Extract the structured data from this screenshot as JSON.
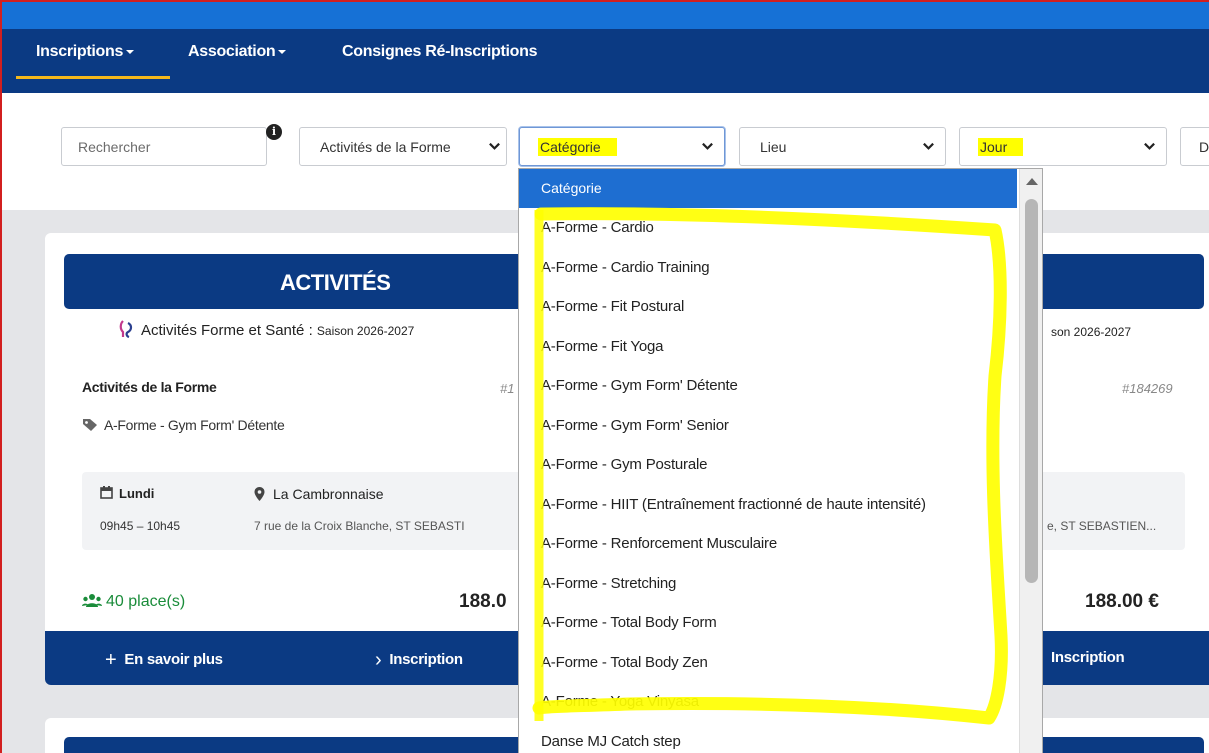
{
  "nav": {
    "inscriptions": "Inscriptions",
    "association": "Association",
    "consignes": "Consignes Ré-Inscriptions"
  },
  "filters": {
    "search_placeholder": "Rechercher",
    "activite": "Activités de la Forme",
    "categorie": "Catégorie",
    "lieu": "Lieu",
    "jour": "Jour",
    "cut": "D"
  },
  "card": {
    "banner_title": "ACTIVITÉS",
    "left": {
      "subtitle_main": "Activités Forme et Santé :",
      "subtitle_season": "Saison 2026-2027",
      "activity_name": "Activités de la Forme",
      "activity_id": "#1",
      "category": "A-Forme - Gym Form' Détente",
      "day": "Lundi",
      "time": "09h45 – 10h45",
      "place": "La Cambronnaise",
      "address": "7 rue de la Croix Blanche, ST SEBASTI",
      "places": "40 place(s)",
      "price": "188.0",
      "more_label": "En savoir plus",
      "inscription_label": "Inscription"
    },
    "right": {
      "subtitle_season": "son 2026-2027",
      "activity_id": "#184269",
      "address": "e, ST SEBASTIEN...",
      "price": "188.00 €",
      "inscription_label": "Inscription"
    }
  },
  "dropdown": {
    "header": "Catégorie",
    "options": [
      "A-Forme - Cardio",
      "A-Forme - Cardio Training",
      "A-Forme - Fit Postural",
      "A-Forme - Fit Yoga",
      "A-Forme - Gym Form' Détente",
      "A-Forme - Gym Form' Senior",
      "A-Forme - Gym Posturale",
      "A-Forme - HIIT (Entraînement fractionné de haute intensité)",
      "A-Forme - Renforcement Musculaire",
      "A-Forme - Stretching",
      "A-Forme - Total Body Form",
      "A-Forme - Total Body Zen",
      "A-Forme - Yoga Vinyasa",
      "Danse MJ Catch step"
    ]
  },
  "colors": {
    "nav_bg": "#0b3a83",
    "top_bar": "#1671d6",
    "highlight": "#ffff00",
    "accent_underline": "#f5b81c",
    "places_green": "#1a8c3a",
    "dropdown_selected": "#1e6ed1"
  },
  "icons": [
    "info-icon",
    "chevron-down-icon",
    "tag-icon",
    "calendar-icon",
    "map-pin-icon",
    "users-icon",
    "plus-icon",
    "chevron-right-icon"
  ]
}
